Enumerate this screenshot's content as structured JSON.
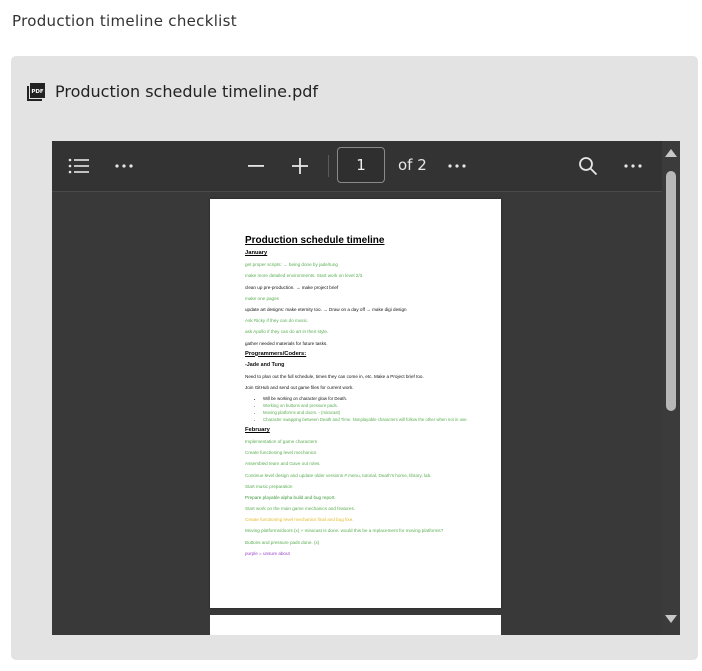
{
  "page_title": "Production timeline checklist",
  "attachment": {
    "icon": "pdf-file-icon",
    "file_name": "Production schedule timeline.pdf"
  },
  "viewer": {
    "toolbar": {
      "outline_icon": "list-icon",
      "more_icon": "ellipsis-icon",
      "zoom_out_icon": "minus-icon",
      "zoom_in_icon": "plus-icon",
      "current_page": "1",
      "page_total_label": "of 2",
      "page_more_icon": "ellipsis-icon",
      "search_icon": "search-icon",
      "overflow_icon": "ellipsis-icon"
    },
    "colors": {
      "toolbar_bg": "#333333",
      "viewer_bg": "#393939",
      "card_bg": "#e3e3e3"
    }
  },
  "document": {
    "title": "Production schedule timeline",
    "lines": [
      {
        "text": "January",
        "style": "heading",
        "color": "black"
      },
      {
        "text": "get proper scripts: → being done by jade/tung",
        "color": "green"
      },
      {
        "text": "make more detailed environments. Start work on level 2/3.",
        "color": "green"
      },
      {
        "text": "clean up pre-production. → make project brief",
        "color": "black"
      },
      {
        "text": "make one pages",
        "color": "green"
      },
      {
        "text": "update art designs: make eternity too. → Draw on a day off → make digi design",
        "color": "black"
      },
      {
        "text": "Ask Ricky if they can do music.",
        "color": "green"
      },
      {
        "text": "ask Apollo if they can do art in their style.",
        "color": "green"
      },
      {
        "text": "gather needed materials for future tasks.",
        "color": "black"
      },
      {
        "text": "Programmers/Coders:",
        "style": "heading",
        "color": "black"
      },
      {
        "text": "-Jade and Tung",
        "style": "bold",
        "color": "black"
      },
      {
        "text": "Need to plan out the full schedule, times they can come in, etc. Make a Project brief too.",
        "color": "black"
      },
      {
        "text": "Join GitHub and send out game files for current work.",
        "color": "black"
      }
    ],
    "bullets": [
      {
        "text": "Will be working on character glow for Death.",
        "color": "black"
      },
      {
        "text": "Working on buttons and pressure pads.",
        "color": "green"
      },
      {
        "text": "Moving platforms and doors. - (miracast)",
        "color": "green"
      },
      {
        "text": "Character swapping between Death and Time. Nonplayable characters will follow the other when not in use.",
        "color": "green"
      }
    ],
    "lines2": [
      {
        "text": "February",
        "style": "heading",
        "color": "black"
      },
      {
        "text": "Implementation of game characters",
        "color": "green"
      },
      {
        "text": "Create functioning level mechanics",
        "color": "green"
      },
      {
        "text": "Assembled team and Gave out roles.",
        "color": "green"
      },
      {
        "text": "Continue level design and update older versions # menu, tutorial, Death's home, library, lab.",
        "color": "green"
      },
      {
        "text": "Start music preparation",
        "color": "green"
      },
      {
        "text": "Prepare playable alpha build and bug report.",
        "color": "dgreen"
      },
      {
        "text": "Start work on the main game mechanics and features.",
        "color": "green"
      },
      {
        "text": "Create functioning level mechanics final and bug fixe.",
        "color": "yellow"
      },
      {
        "text": "Moving platforms/doors (x) + miracast is done. would this be a replacement for moving platforms?",
        "color": "green"
      },
      {
        "text": "Buttons and pressure pads done. (x)",
        "color": "green"
      },
      {
        "text": "purple = unsure about",
        "color": "purple"
      }
    ]
  }
}
